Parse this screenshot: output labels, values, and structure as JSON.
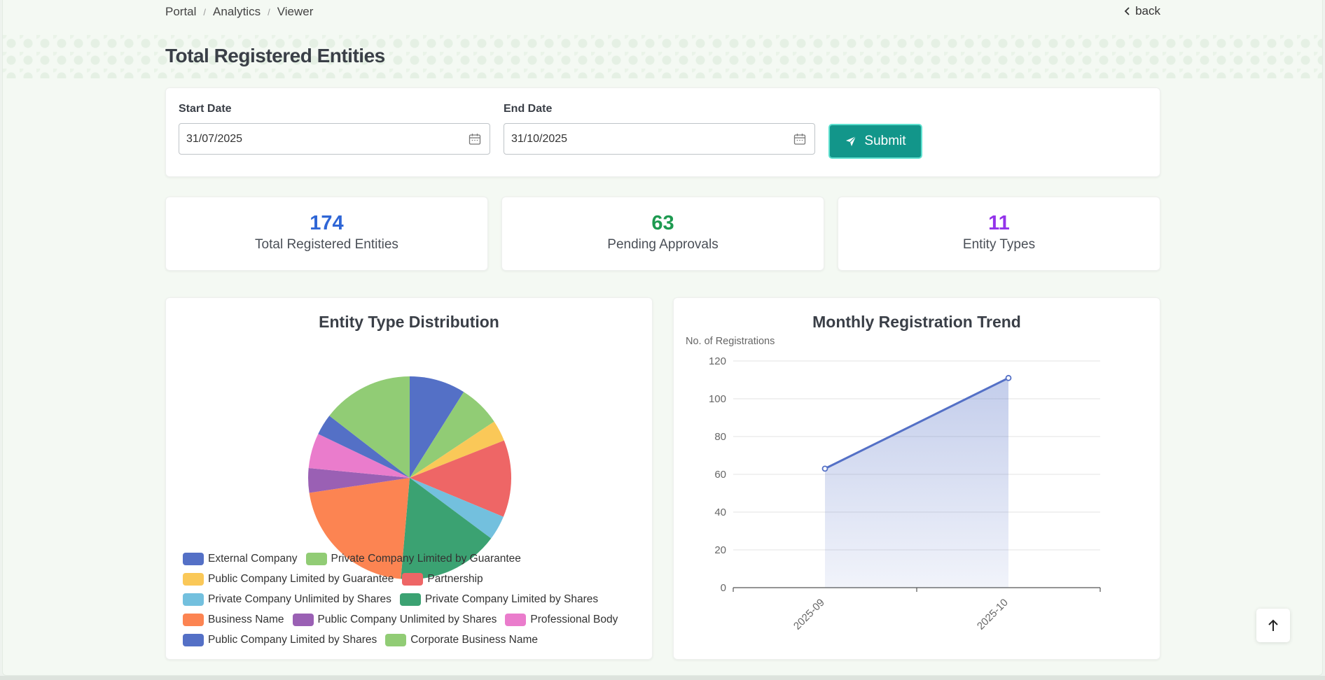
{
  "breadcrumb": [
    "Portal",
    "Analytics",
    "Viewer"
  ],
  "back_label": "back",
  "page_title": "Total Registered Entities",
  "filter": {
    "start_label": "Start Date",
    "start_value": "31/07/2025",
    "end_label": "End Date",
    "end_value": "31/10/2025",
    "submit_label": "Submit",
    "accent": "#12968a"
  },
  "stats": [
    {
      "value": "174",
      "label": "Total Registered Entities",
      "color": "#2f66d6"
    },
    {
      "value": "63",
      "label": "Pending Approvals",
      "color": "#1d9a50"
    },
    {
      "value": "11",
      "label": "Entity Types",
      "color": "#9333ea"
    }
  ],
  "chart_data": [
    {
      "type": "pie",
      "title": "Entity Type Distribution",
      "categories": [
        "External Company",
        "Private Company Limited by Guarantee",
        "Public Company Limited by Guarantee",
        "Partnership",
        "Private Company Unlimited by Shares",
        "Private Company Limited by Shares",
        "Business Name",
        "Public Company Unlimited by Shares",
        "Professional Body",
        "Public Company Limited by Shares",
        "Corporate Business Name"
      ],
      "values": [
        16,
        12,
        6,
        22,
        7,
        29,
        38,
        7,
        10,
        6,
        26
      ],
      "colors": [
        "#5470c6",
        "#91cc75",
        "#fac858",
        "#ee6666",
        "#73c0de",
        "#3ba272",
        "#fc8452",
        "#9a60b4",
        "#ea7ccc",
        "#5470c6",
        "#91cc75"
      ],
      "legend": "bottom-left"
    },
    {
      "type": "area",
      "title": "Monthly Registration Trend",
      "ylabel": "No. of Registrations",
      "categories": [
        "2025-09",
        "2025-10"
      ],
      "values": [
        63,
        111
      ],
      "ylim": [
        0,
        120
      ],
      "yticks": [
        "0",
        "20",
        "40",
        "60",
        "80",
        "100",
        "120"
      ],
      "grid": true,
      "color": "#5470c6"
    }
  ]
}
